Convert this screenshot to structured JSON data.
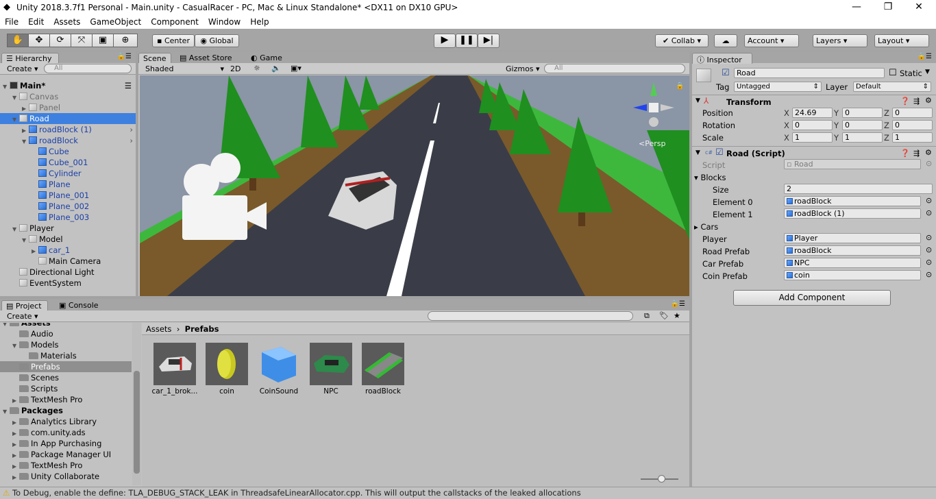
{
  "window": {
    "title": "Unity 2018.3.7f1 Personal - Main.unity - CasualRacer - PC, Mac & Linux Standalone* <DX11 on DX10 GPU>",
    "minimize": "—",
    "maximize": "❐",
    "close": "✕"
  },
  "menu": [
    "File",
    "Edit",
    "Assets",
    "GameObject",
    "Component",
    "Window",
    "Help"
  ],
  "toolbar": {
    "center": "Center",
    "global": "Global",
    "collab": "Collab ▾",
    "account": "Account",
    "layers": "Layers",
    "layout": "Layout"
  },
  "hierarchy": {
    "tab": "Hierarchy",
    "create": "Create",
    "search_placeholder": "All",
    "rows": [
      {
        "label": "Main*",
        "depth": 0,
        "icon": "unity",
        "expanded": true,
        "bold": true
      },
      {
        "label": "Canvas",
        "depth": 1,
        "icon": "cube",
        "expanded": true,
        "grey": true
      },
      {
        "label": "Panel",
        "depth": 2,
        "icon": "cube",
        "collapsed": true,
        "grey": true
      },
      {
        "label": "Road",
        "depth": 1,
        "icon": "cube",
        "expanded": true,
        "selected": true
      },
      {
        "label": "roadBlock (1)",
        "depth": 2,
        "icon": "prefab",
        "collapsed": true,
        "prefab": true
      },
      {
        "label": "roadBlock",
        "depth": 2,
        "icon": "prefab",
        "expanded": true,
        "prefab": true
      },
      {
        "label": "Cube",
        "depth": 3,
        "icon": "prefab",
        "prefab": true
      },
      {
        "label": "Cube_001",
        "depth": 3,
        "icon": "prefab",
        "prefab": true
      },
      {
        "label": "Cylinder",
        "depth": 3,
        "icon": "prefab",
        "prefab": true
      },
      {
        "label": "Plane",
        "depth": 3,
        "icon": "prefab",
        "prefab": true
      },
      {
        "label": "Plane_001",
        "depth": 3,
        "icon": "prefab",
        "prefab": true
      },
      {
        "label": "Plane_002",
        "depth": 3,
        "icon": "prefab",
        "prefab": true
      },
      {
        "label": "Plane_003",
        "depth": 3,
        "icon": "prefab",
        "prefab": true
      },
      {
        "label": "Player",
        "depth": 1,
        "icon": "cube",
        "expanded": true
      },
      {
        "label": "Model",
        "depth": 2,
        "icon": "cube",
        "expanded": true
      },
      {
        "label": "car_1",
        "depth": 3,
        "icon": "model",
        "collapsed": true,
        "prefab": true
      },
      {
        "label": "Main Camera",
        "depth": 3,
        "icon": "cube"
      },
      {
        "label": "Directional Light",
        "depth": 1,
        "icon": "cube"
      },
      {
        "label": "EventSystem",
        "depth": 1,
        "icon": "cube"
      }
    ]
  },
  "scene": {
    "tabs": [
      "Scene",
      "Asset Store",
      "Game"
    ],
    "shading": "Shaded",
    "mode2d": "2D",
    "gizmos": "Gizmos",
    "search_placeholder": "All",
    "persp": "<Persp"
  },
  "inspector": {
    "tab": "Inspector",
    "name": "Road",
    "static": "Static",
    "tag_label": "Tag",
    "tag": "Untagged",
    "layer_label": "Layer",
    "layer": "Default",
    "transform": {
      "title": "Transform",
      "rows": [
        {
          "label": "Position",
          "x": "24.69",
          "y": "0",
          "z": "0"
        },
        {
          "label": "Rotation",
          "x": "0",
          "y": "0",
          "z": "0"
        },
        {
          "label": "Scale",
          "x": "1",
          "y": "1",
          "z": "1"
        }
      ]
    },
    "script": {
      "title": "Road (Script)",
      "script_label": "Script",
      "script_value": "Road",
      "blocks": "Blocks",
      "size_label": "Size",
      "size": "2",
      "elements": [
        {
          "label": "Element 0",
          "value": "roadBlock"
        },
        {
          "label": "Element 1",
          "value": "roadBlock (1)"
        }
      ],
      "cars": "Cars",
      "refs": [
        {
          "label": "Player",
          "value": "Player"
        },
        {
          "label": "Road Prefab",
          "value": "roadBlock"
        },
        {
          "label": "Car Prefab",
          "value": "NPC"
        },
        {
          "label": "Coin Prefab",
          "value": "coin"
        }
      ]
    },
    "add_component": "Add Component"
  },
  "project": {
    "tabs": [
      "Project",
      "Console"
    ],
    "create": "Create",
    "tree": [
      {
        "label": "Assets",
        "depth": 0,
        "bold": true
      },
      {
        "label": "Audio",
        "depth": 1
      },
      {
        "label": "Models",
        "depth": 1,
        "expanded": true
      },
      {
        "label": "Materials",
        "depth": 2
      },
      {
        "label": "Prefabs",
        "depth": 1,
        "selected": true
      },
      {
        "label": "Scenes",
        "depth": 1
      },
      {
        "label": "Scripts",
        "depth": 1
      },
      {
        "label": "TextMesh Pro",
        "depth": 1,
        "collapsed": true
      },
      {
        "label": "Packages",
        "depth": 0,
        "bold": true
      },
      {
        "label": "Analytics Library",
        "depth": 1,
        "collapsed": true
      },
      {
        "label": "com.unity.ads",
        "depth": 1,
        "collapsed": true
      },
      {
        "label": "In App Purchasing",
        "depth": 1,
        "collapsed": true
      },
      {
        "label": "Package Manager UI",
        "depth": 1,
        "collapsed": true
      },
      {
        "label": "TextMesh Pro",
        "depth": 1,
        "collapsed": true
      },
      {
        "label": "Unity Collaborate",
        "depth": 1,
        "collapsed": true
      }
    ],
    "breadcrumb": [
      "Assets",
      "Prefabs"
    ],
    "assets": [
      {
        "label": "car_1_brok...",
        "kind": "car"
      },
      {
        "label": "coin",
        "kind": "coin"
      },
      {
        "label": "CoinSound",
        "kind": "cube"
      },
      {
        "label": "NPC",
        "kind": "npc"
      },
      {
        "label": "roadBlock",
        "kind": "road"
      }
    ]
  },
  "status": {
    "message": "To Debug, enable the define: TLA_DEBUG_STACK_LEAK in ThreadsafeLinearAllocator.cpp. This will output the callstacks of the leaked allocations",
    "icon": "warning-icon"
  },
  "colors": {
    "selection": "#3d80df",
    "prefab_text": "#1a3fa8",
    "panel": "#c2c2c2"
  }
}
